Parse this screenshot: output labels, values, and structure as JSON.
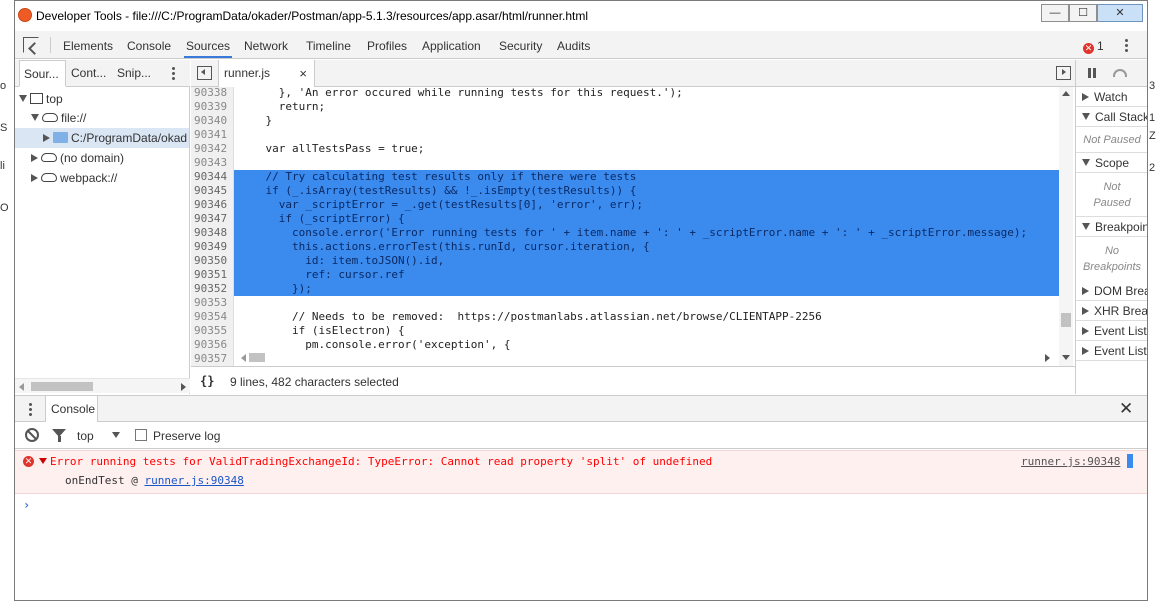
{
  "background": {
    "left_fragments": [
      "o",
      "S",
      "li",
      "O"
    ],
    "right_fragments": [
      "3",
      "1",
      "Z",
      "2"
    ]
  },
  "window": {
    "title": "Developer Tools - file:///C:/ProgramData/okader/Postman/app-5.1.3/resources/app.asar/html/runner.html",
    "minimize": "—",
    "maximize": "☐",
    "close": "✕"
  },
  "main_tabs": [
    "Elements",
    "Console",
    "Sources",
    "Network",
    "Timeline",
    "Profiles",
    "Application",
    "Security",
    "Audits"
  ],
  "active_tab": "Sources",
  "error_count": "1",
  "navigator": {
    "tabs": [
      "Sour...",
      "Cont...",
      "Snip..."
    ],
    "tree": {
      "top": "top",
      "file": "file://",
      "folder": "C:/ProgramData/okad",
      "no_domain": "(no domain)",
      "webpack": "webpack://"
    }
  },
  "editor": {
    "file_tab": "runner.js",
    "file_tab_close": "×",
    "status": "9 lines, 482 characters selected",
    "pretty_print": "{}",
    "lines": [
      {
        "n": "90338",
        "code": "      }, 'An error occured while running tests for this request.');",
        "sel": false
      },
      {
        "n": "90339",
        "code": "      return;",
        "sel": false
      },
      {
        "n": "90340",
        "code": "    }",
        "sel": false
      },
      {
        "n": "90341",
        "code": "",
        "sel": false
      },
      {
        "n": "90342",
        "code": "    var allTestsPass = true;",
        "sel": false
      },
      {
        "n": "90343",
        "code": "",
        "sel": false
      },
      {
        "n": "90344",
        "code": "    // Try calculating test results only if there were tests",
        "sel": true
      },
      {
        "n": "90345",
        "code": "    if (_.isArray(testResults) && !_.isEmpty(testResults)) {",
        "sel": true
      },
      {
        "n": "90346",
        "code": "      var _scriptError = _.get(testResults[0], 'error', err);",
        "sel": true
      },
      {
        "n": "90347",
        "code": "      if (_scriptError) {",
        "sel": true
      },
      {
        "n": "90348",
        "code": "        console.error('Error running tests for ' + item.name + ': ' + _scriptError.name + ': ' + _scriptError.message);",
        "sel": true
      },
      {
        "n": "90349",
        "code": "        this.actions.errorTest(this.runId, cursor.iteration, {",
        "sel": true
      },
      {
        "n": "90350",
        "code": "          id: item.toJSON().id,",
        "sel": true
      },
      {
        "n": "90351",
        "code": "          ref: cursor.ref",
        "sel": true
      },
      {
        "n": "90352",
        "code": "        });",
        "sel": true
      },
      {
        "n": "90353",
        "code": "",
        "sel": false
      },
      {
        "n": "90354",
        "code": "        // Needs to be removed:  https://postmanlabs.atlassian.net/browse/CLIENTAPP-2256",
        "sel": false
      },
      {
        "n": "90355",
        "code": "        if (isElectron) {",
        "sel": false
      },
      {
        "n": "90356",
        "code": "          pm.console.error('exception', {",
        "sel": false
      },
      {
        "n": "90357",
        "code": "",
        "sel": false
      }
    ]
  },
  "debugger": {
    "watch": "Watch",
    "call_stack": "Call Stack",
    "not_paused": "Not Paused",
    "scope": "Scope",
    "scope_not_paused_1": "Not",
    "scope_not_paused_2": "Paused",
    "breakpoints": "Breakpoints",
    "no_bp_1": "No",
    "no_bp_2": "Breakpoints",
    "dom_breakpoints": "DOM Breakpoints",
    "xhr_breakpoints": "XHR Breakpoints",
    "event_listeners": "Event Listeners",
    "event_listener_breakpoints": "Event Listener Breakpoints"
  },
  "console": {
    "tab": "Console",
    "close": "✕",
    "context": "top",
    "preserve_log": "Preserve log",
    "error_message": "Error running tests for ValidTradingExchangeId: TypeError: Cannot read property 'split' of undefined",
    "error_source": "runner.js:90348",
    "stack_fn": "onEndTest @ ",
    "stack_link": "runner.js:90348",
    "prompt": "›"
  },
  "colors": {
    "selection": "#3b8bee",
    "error_text": "#ff0000",
    "error_bg": "#fff0f0",
    "active_tab_underline": "#3879d9"
  }
}
